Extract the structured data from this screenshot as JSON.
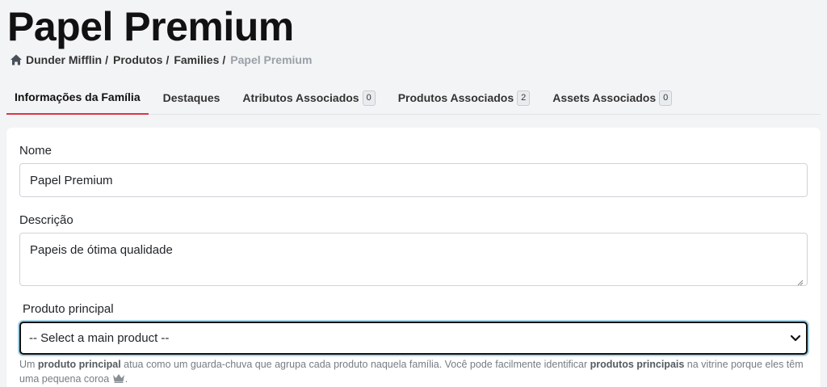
{
  "page": {
    "title": "Papel Premium"
  },
  "breadcrumb": {
    "items": [
      "Dunder Mifflin",
      "Produtos",
      "Families"
    ],
    "current": "Papel Premium"
  },
  "tabs": [
    {
      "label": "Informações da Família",
      "badge": null
    },
    {
      "label": "Destaques",
      "badge": null
    },
    {
      "label": "Atributos Associados",
      "badge": "0"
    },
    {
      "label": "Produtos Associados",
      "badge": "2"
    },
    {
      "label": "Assets Associados",
      "badge": "0"
    }
  ],
  "form": {
    "name_label": "Nome",
    "name_value": "Papel Premium",
    "description_label": "Descrição",
    "description_value": "Papeis de ótima qualidade",
    "main_product_label": "Produto principal",
    "main_product_selected": "-- Select a main product --",
    "help": {
      "p1": "Um ",
      "b1": "produto principal",
      "p2": " atua como um guarda-chuva que agrupa cada produto naquela família. Você pode facilmente identificar ",
      "b2": "produtos principais",
      "p3": " na vitrine porque eles têm uma pequena coroa"
    }
  },
  "colors": {
    "active_tab": "#dc3545",
    "background": "#f3f4f6",
    "card": "#ffffff",
    "focus_ring": "#a8d3e6"
  },
  "icons": {
    "breadcrumb_home": "home-icon",
    "crown": "crown-icon",
    "select": "chevron-down-icon"
  }
}
